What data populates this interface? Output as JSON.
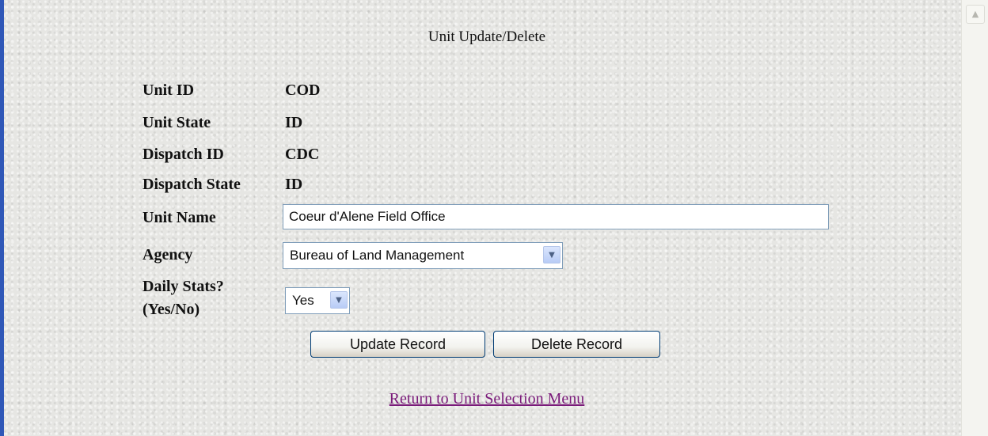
{
  "page": {
    "title": "Unit Update/Delete"
  },
  "fields": {
    "unit_id": {
      "label": "Unit ID",
      "value": "COD"
    },
    "unit_state": {
      "label": "Unit State",
      "value": "ID"
    },
    "dispatch_id": {
      "label": "Dispatch ID",
      "value": "CDC"
    },
    "dispatch_state": {
      "label": "Dispatch State",
      "value": "ID"
    },
    "unit_name": {
      "label": "Unit Name",
      "value": "Coeur d'Alene Field Office"
    },
    "agency": {
      "label": "Agency",
      "value": "Bureau of Land Management"
    },
    "daily_stats": {
      "label_line1": "Daily Stats?",
      "label_line2": "(Yes/No)",
      "value": "Yes"
    }
  },
  "buttons": {
    "update": "Update Record",
    "delete": "Delete Record"
  },
  "links": {
    "return": "Return to Unit Selection Menu"
  },
  "icons": {
    "dropdown": "chevron-down-icon",
    "scroll_up": "scroll-up-icon"
  },
  "colors": {
    "accent_bar": "#2f57b7",
    "link": "#7a1a7a"
  }
}
